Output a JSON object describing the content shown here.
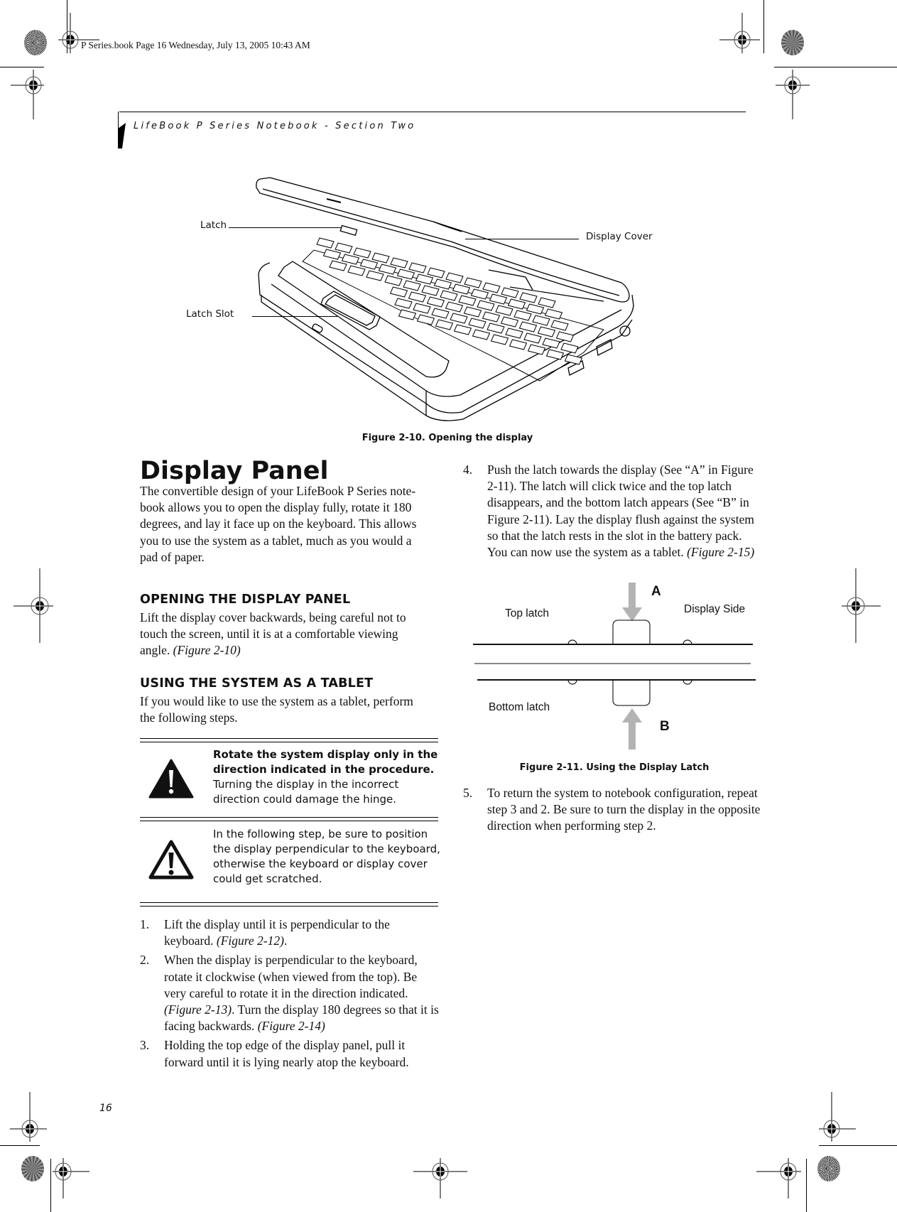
{
  "print_slug": "P Series.book  Page 16  Wednesday, July 13, 2005  10:43 AM",
  "running_head": "LifeBook P Series Notebook - Section Two",
  "figure_2_10": {
    "callouts": {
      "latch": "Latch",
      "latch_slot": "Latch Slot",
      "display_cover": "Display Cover"
    },
    "caption": "Figure 2-10. Opening the display"
  },
  "section": {
    "title": "Display Panel",
    "intro": "The convertible design of your LifeBook P Series notebook allows you to open the display fully, rotate it 180 degrees, and lay it face up on the keyboard. This allows you to use the system as a tablet, much as you would a pad of paper.",
    "intro_lines": [
      "The convertible design of your LifeBook P Series note-",
      "book allows you to open the display fully, rotate it 180",
      "degrees, and lay it face up on the keyboard. This allows",
      "you to use the system as a tablet, much as you would a",
      "pad of paper."
    ],
    "opening": {
      "heading": "OPENING THE DISPLAY PANEL",
      "lines": [
        "Lift the display cover backwards, being careful not to",
        "touch the screen, until it is at a comfortable viewing"
      ],
      "last_line": "angle. ",
      "ref": "(Figure 2-10)"
    },
    "tablet": {
      "heading": "USING THE SYSTEM AS A TABLET",
      "lines": [
        "If you would like to use the system as a tablet, perform",
        "the following steps."
      ]
    }
  },
  "notes": [
    {
      "icon": "caution-icon",
      "bold": "Rotate the system display only in the direction indicated in the procedure.",
      "bold_lines": [
        "Rotate the system display only in the",
        "direction indicated in the procedure."
      ],
      "text_lines": [
        "Turning the display in the incorrect",
        "direction could damage the hinge."
      ]
    },
    {
      "icon": "warning-icon",
      "text_lines": [
        "In the following step, be sure to position",
        "the display perpendicular to the keyboard,",
        "otherwise the keyboard or display cover",
        "could get scratched."
      ]
    }
  ],
  "steps": [
    {
      "num": "1.",
      "text": "Lift the display until it is perpendicular to the keyboard. ",
      "ref": "(Figure 2-12)",
      "tail": "."
    },
    {
      "num": "2.",
      "text": "When the display is perpendicular to the keyboard, rotate it clockwise (when viewed from the top). Be very careful to rotate it in the direction indicated. ",
      "ref": "(Figure 2-13)",
      "tail": ". Turn the display 180 degrees so that it is facing backwards. ",
      "ref2": "(Figure 2-14)"
    },
    {
      "num": "3.",
      "text": "Holding the top edge of the display panel, pull it forward until it is lying nearly atop the keyboard."
    },
    {
      "num": "4.",
      "text": "Push the latch towards the display (See “A” in Figure 2-11). The latch will click twice and the top latch disappears, and the bottom latch appears (See “B” in Figure 2-11). Lay the display flush against the system so that the latch rests in the slot in the battery pack. You can now use the system as a tablet. ",
      "ref": "(Figure 2-15)"
    },
    {
      "num": "5.",
      "text": "To return the system to notebook configuration, repeat step 3 and 2. Be sure to turn the display in the opposite direction when performing step 2."
    }
  ],
  "figure_2_11": {
    "labels": {
      "a": "A",
      "b": "B",
      "top_latch": "Top latch",
      "bottom_latch": "Bottom latch",
      "display_side": "Display Side"
    },
    "caption": "Figure 2-11. Using the Display Latch",
    "arrow_color": "#b3b3b3"
  },
  "page_number": "16"
}
